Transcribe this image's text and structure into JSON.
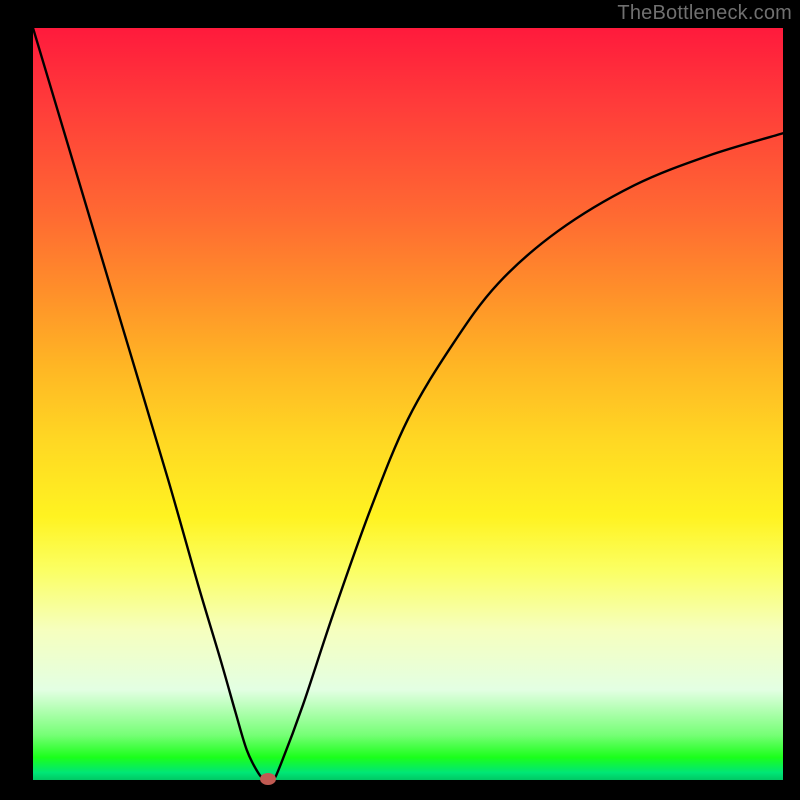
{
  "attribution": "TheBottleneck.com",
  "plot": {
    "inner_left": 33,
    "inner_top": 28,
    "inner_width": 750,
    "inner_height": 752
  },
  "chart_data": {
    "type": "line",
    "title": "",
    "xlabel": "",
    "ylabel": "",
    "xlim": [
      0,
      100
    ],
    "ylim": [
      0,
      100
    ],
    "grid": false,
    "series": [
      {
        "name": "bottleneck-curve",
        "x": [
          0,
          6,
          12,
          18,
          22,
          25,
          27,
          28.5,
          30,
          31,
          32,
          33,
          36,
          40,
          45,
          50,
          56,
          62,
          70,
          80,
          90,
          100
        ],
        "values": [
          100,
          80,
          60,
          40,
          26,
          16,
          9,
          4,
          1,
          0,
          0,
          2,
          10,
          22,
          36,
          48,
          58,
          66,
          73,
          79,
          83,
          86
        ]
      }
    ],
    "annotations": [
      {
        "name": "min-marker",
        "x": 31.3,
        "y": 0
      }
    ],
    "background_gradient": {
      "top_color": "#ff1a3c",
      "bottom_color": "#00c864"
    }
  }
}
